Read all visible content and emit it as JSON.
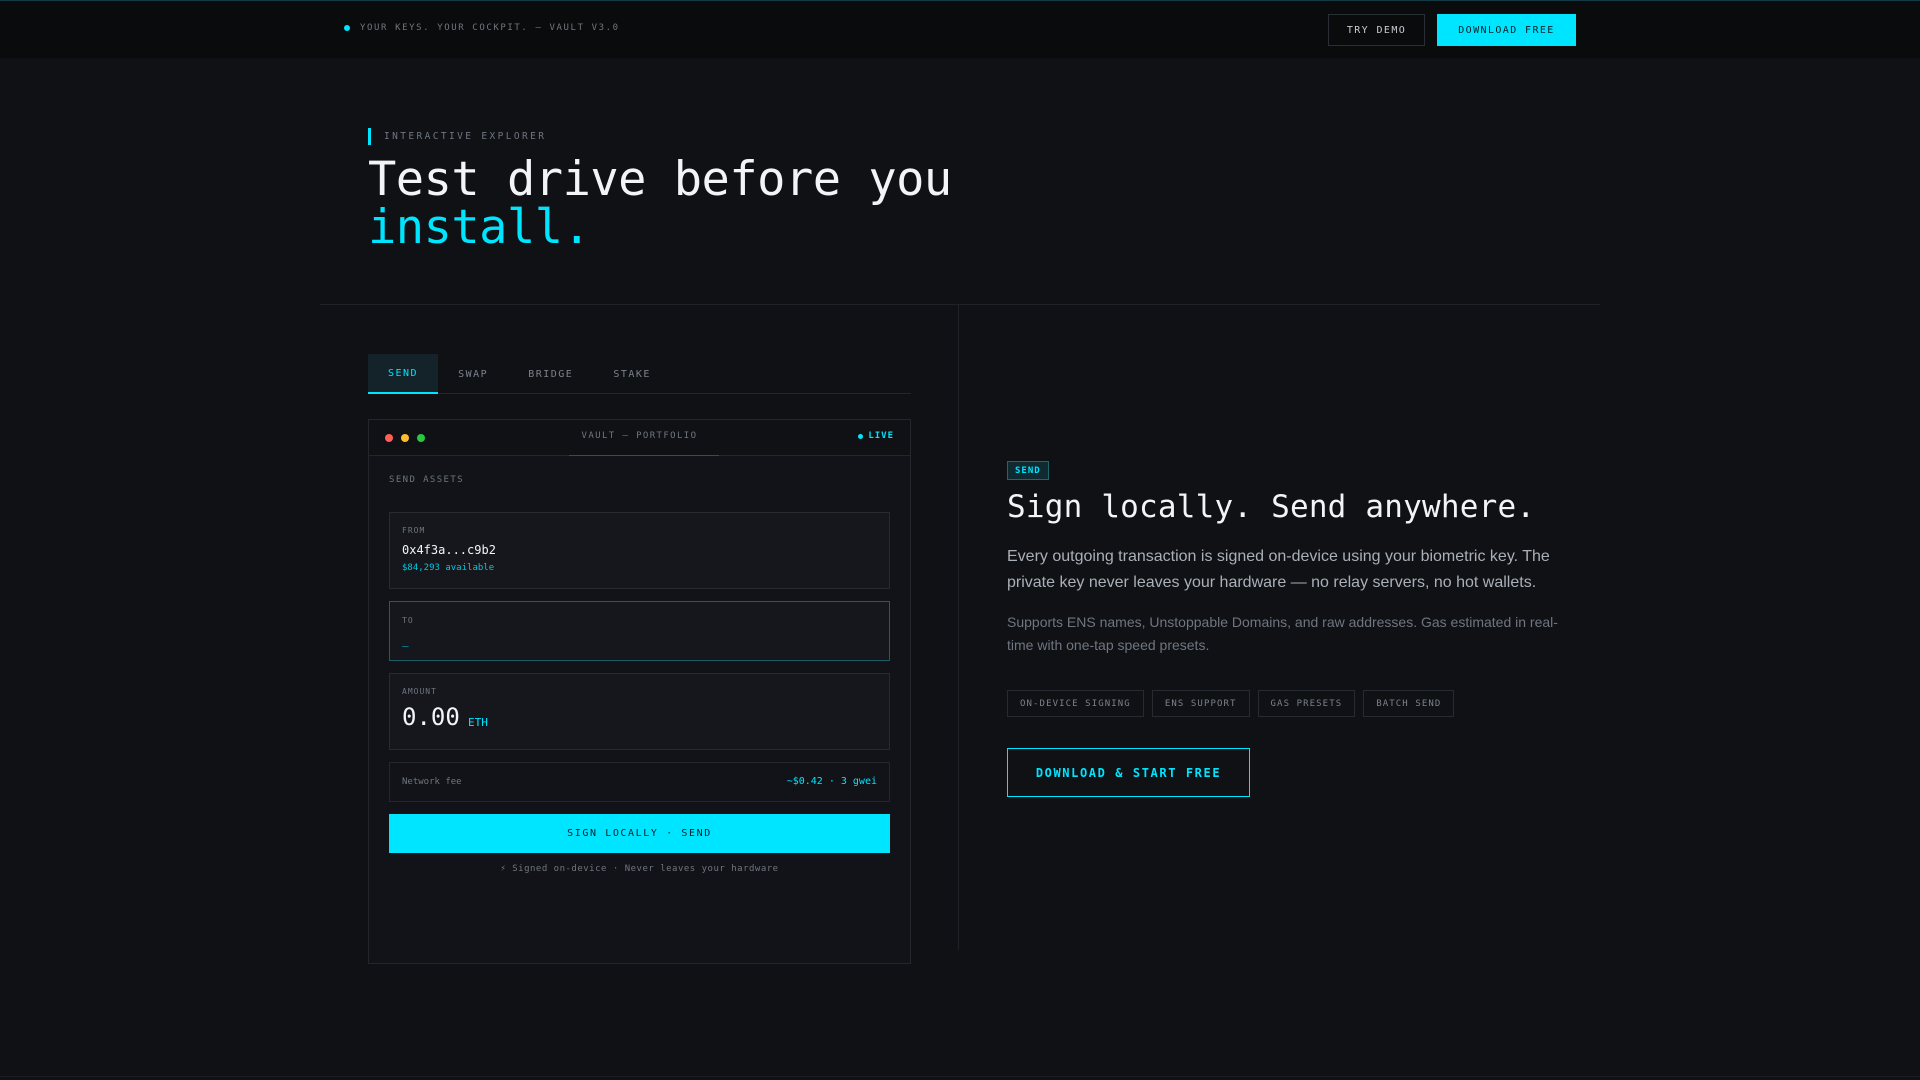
{
  "topbar": {
    "tagline": "YOUR KEYS. YOUR COCKPIT. — VAULT V3.0",
    "try_demo": "TRY DEMO",
    "download": "DOWNLOAD FREE"
  },
  "hero": {
    "eyebrow": "INTERACTIVE EXPLORER",
    "title_line1": "Test drive before you",
    "title_line2": "install."
  },
  "tabs": [
    {
      "label": "SEND",
      "active": true
    },
    {
      "label": "SWAP",
      "active": false
    },
    {
      "label": "BRIDGE",
      "active": false
    },
    {
      "label": "STAKE",
      "active": false
    }
  ],
  "window": {
    "title": "VAULT — PORTFOLIO",
    "status": "LIVE",
    "lights": [
      "#ff5f57",
      "#febc2e",
      "#28c840"
    ],
    "section_label": "SEND ASSETS",
    "from": {
      "label": "FROM",
      "address": "0x4f3a...c9b2",
      "available": "$84,293 available"
    },
    "to": {
      "label": "TO",
      "cursor": "_"
    },
    "amount": {
      "label": "AMOUNT",
      "value": "0.00",
      "unit": "ETH"
    },
    "fee": {
      "label": "Network fee",
      "value": "~$0.42 · 3 gwei"
    },
    "sign_button": "SIGN LOCALLY · SEND",
    "note": "⚡ Signed on-device · Never leaves your hardware"
  },
  "detail": {
    "badge": "SEND",
    "title": "Sign locally. Send anywhere.",
    "body": "Every outgoing transaction is signed on-device using your biometric key. The private key never leaves your hardware — no relay servers, no hot wallets.",
    "sub": "Supports ENS names, Unstoppable Domains, and raw addresses. Gas estimated in real-time with one-tap speed presets.",
    "chips": [
      "ON-DEVICE SIGNING",
      "ENS SUPPORT",
      "GAS PRESETS",
      "BATCH SEND"
    ],
    "cta": "DOWNLOAD & START FREE"
  },
  "colors": {
    "accent": "#00e5ff",
    "background": "#0f1115",
    "topbar": "#0a0b0d"
  }
}
